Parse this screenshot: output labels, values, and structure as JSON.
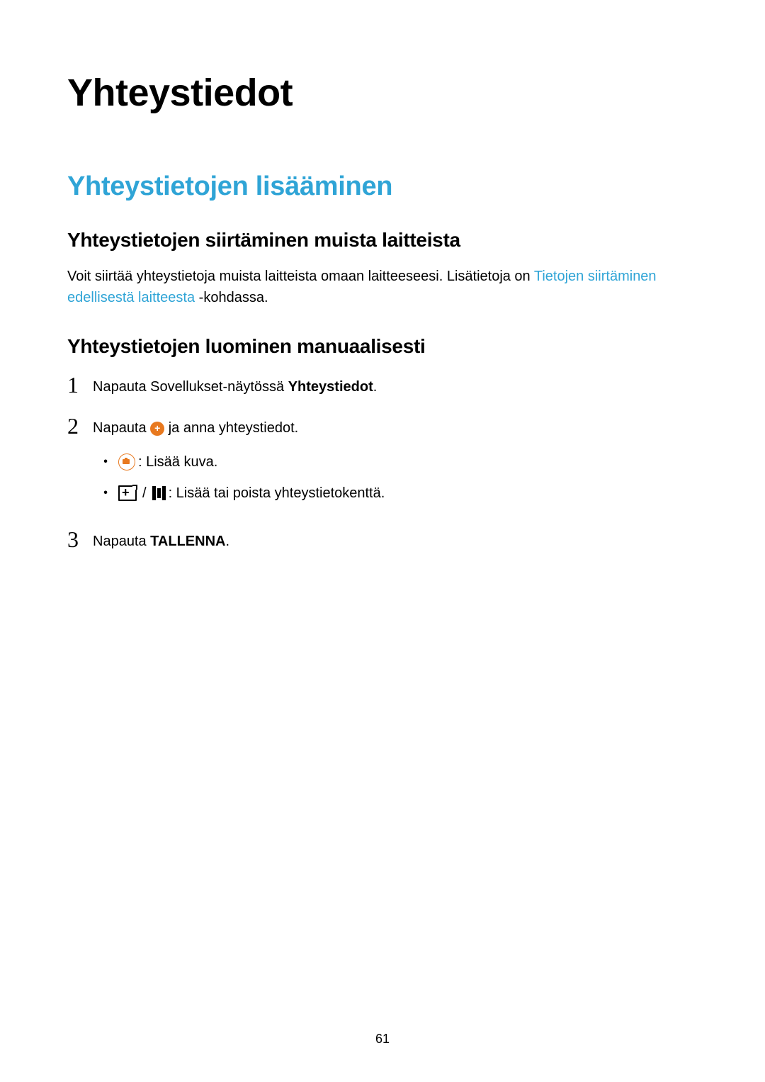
{
  "page": {
    "number": "61"
  },
  "title": "Yhteystiedot",
  "section1": {
    "heading": "Yhteystietojen lisääminen",
    "sub1": {
      "heading": "Yhteystietojen siirtäminen muista laitteista",
      "para_pre": "Voit siirtää yhteystietoja muista laitteista omaan laitteeseesi. Lisätietoja on ",
      "link": "Tietojen siirtäminen edellisestä laitteesta",
      "para_post": " -kohdassa."
    },
    "sub2": {
      "heading": "Yhteystietojen luominen manuaalisesti",
      "steps": {
        "s1": {
          "num": "1",
          "pre": "Napauta Sovellukset-näytössä ",
          "bold": "Yhteystiedot",
          "post": "."
        },
        "s2": {
          "num": "2",
          "pre": "Napauta ",
          "post": " ja anna yhteystiedot.",
          "bullet_a": " : Lisää kuva.",
          "bullet_b": " : Lisää tai poista yhteystietokenttä."
        },
        "s3": {
          "num": "3",
          "pre": "Napauta ",
          "bold": "TALLENNA",
          "post": "."
        }
      }
    }
  }
}
